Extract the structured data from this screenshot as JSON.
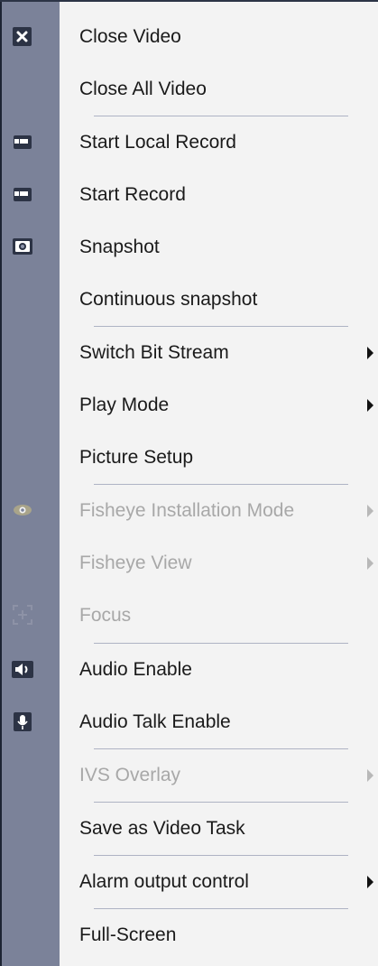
{
  "menu": {
    "items": [
      {
        "label": "Close Video",
        "icon": "close-icon",
        "enabled": true,
        "submenu": false
      },
      {
        "label": "Close All Video",
        "icon": "",
        "enabled": true,
        "submenu": false
      },
      {
        "label": "Start Local Record",
        "icon": "camera-icon",
        "enabled": true,
        "submenu": false
      },
      {
        "label": "Start Record",
        "icon": "camera-icon",
        "enabled": true,
        "submenu": false
      },
      {
        "label": "Snapshot",
        "icon": "snapshot-icon",
        "enabled": true,
        "submenu": false
      },
      {
        "label": "Continuous snapshot",
        "icon": "",
        "enabled": true,
        "submenu": false
      },
      {
        "label": "Switch Bit Stream",
        "icon": "",
        "enabled": true,
        "submenu": true
      },
      {
        "label": "Play Mode",
        "icon": "",
        "enabled": true,
        "submenu": true
      },
      {
        "label": "Picture Setup",
        "icon": "",
        "enabled": true,
        "submenu": false
      },
      {
        "label": "Fisheye Installation Mode",
        "icon": "eye-icon",
        "enabled": false,
        "submenu": true
      },
      {
        "label": "Fisheye View",
        "icon": "",
        "enabled": false,
        "submenu": true
      },
      {
        "label": "Focus",
        "icon": "focus-icon",
        "enabled": false,
        "submenu": false
      },
      {
        "label": "Audio Enable",
        "icon": "speaker-icon",
        "enabled": true,
        "submenu": false
      },
      {
        "label": "Audio Talk Enable",
        "icon": "microphone-icon",
        "enabled": true,
        "submenu": false
      },
      {
        "label": "IVS Overlay",
        "icon": "",
        "enabled": false,
        "submenu": true
      },
      {
        "label": "Save as Video Task",
        "icon": "",
        "enabled": true,
        "submenu": false
      },
      {
        "label": "Alarm output control",
        "icon": "",
        "enabled": true,
        "submenu": true
      },
      {
        "label": "Full-Screen",
        "icon": "",
        "enabled": true,
        "submenu": false
      }
    ]
  },
  "colors": {
    "gutter": "#7b8299",
    "menu_background": "#f3f3f3",
    "text": "#1a1a1a",
    "disabled_text": "#a8a8a8",
    "separator": "#aeb3c4"
  }
}
